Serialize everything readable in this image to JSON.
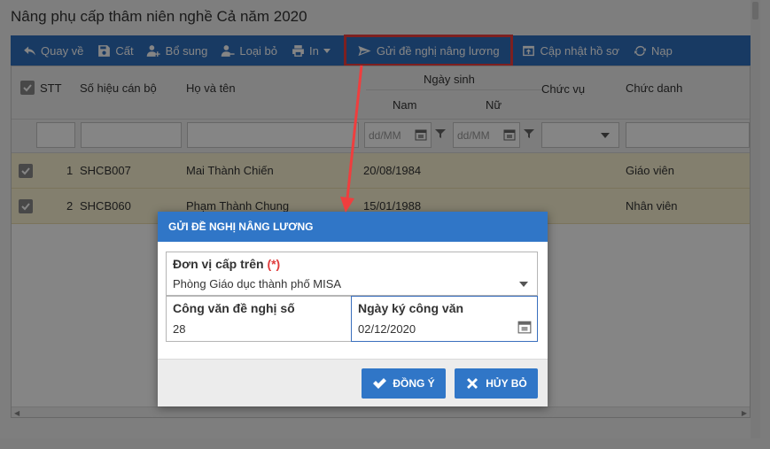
{
  "window": {
    "title": "Nâng phụ cấp thâm niên nghề Cả năm 2020"
  },
  "toolbar": {
    "back": "Quay về",
    "save": "Cất",
    "add": "Bổ sung",
    "remove": "Loại bỏ",
    "print": "In",
    "send": "Gửi đề nghị nâng lương",
    "update": "Cập nhật hồ sơ",
    "reload": "Nạp"
  },
  "grid": {
    "headers": {
      "stt": "STT",
      "code": "Số hiệu cán bộ",
      "name": "Họ và tên",
      "dob": "Ngày sinh",
      "male": "Nam",
      "female": "Nữ",
      "position": "Chức vụ",
      "title": "Chức danh"
    },
    "filters": {
      "date_placeholder": "dd/MM"
    },
    "rows": [
      {
        "stt": "1",
        "code": "SHCB007",
        "name": "Mai Thành Chiến",
        "dob": "20/08/1984",
        "title": "Giáo viên"
      },
      {
        "stt": "2",
        "code": "SHCB060",
        "name": "Phạm Thành Chung",
        "dob": "15/01/1988",
        "title": "Nhân viên"
      }
    ]
  },
  "dialog": {
    "title": "GỬI ĐỀ NGHỊ NÂNG LƯƠNG",
    "unit_label": "Đơn vị cấp trên",
    "unit_required": "(*)",
    "unit_value": "Phòng Giáo dục thành phố MISA",
    "doc_label": "Công văn đề nghị số",
    "doc_value": "28",
    "date_label": "Ngày ký công văn",
    "date_value": "02/12/2020",
    "ok": "ĐỒNG Ý",
    "cancel": "HỦY BỎ"
  },
  "colors": {
    "primary": "#3076c7",
    "highlight": "#ef3e3e",
    "row_selected": "#fbf4d4"
  }
}
